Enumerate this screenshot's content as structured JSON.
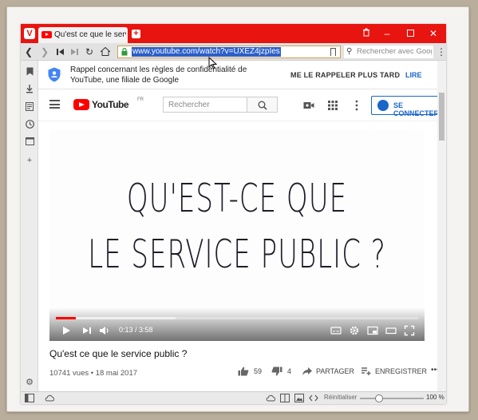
{
  "browser": {
    "logo": "V",
    "tab_title": "Qu'est ce que le service public",
    "new_tab": "+",
    "url": "www.youtube.com/watch?v=UXEZ4jzpIes",
    "search_placeholder": "Rechercher avec Goog",
    "accent": "#e8140f",
    "icons": [
      "back-icon",
      "forward-icon",
      "rewind-icon",
      "fast-forward-icon",
      "reload-icon",
      "home-icon",
      "lock-icon",
      "bookmark-icon",
      "search-icon",
      "menu-icon"
    ]
  },
  "notice": {
    "text": "Rappel concernant les règles de confidentialité de YouTube, une filiale de Google",
    "remind_later": "ME LE RAPPELER PLUS TARD",
    "read": "LIRE"
  },
  "youtube": {
    "logo_text": "YouTube",
    "region": "FR",
    "search_placeholder": "Rechercher",
    "sign_in": "SE CONNECTER"
  },
  "video": {
    "line1": "QU'EST-CE QUE",
    "line2": "LE SERVICE PUBLIC ?",
    "time": "0:13 / 3:58",
    "progress_fraction": 0.055,
    "title": "Qu'est ce que le service public ?",
    "meta": "10741 vues • 18 mai 2017",
    "likes": "59",
    "dislikes": "4",
    "share": "PARTAGER",
    "save": "ENREGISTRER",
    "more": "•••"
  },
  "status": {
    "reset": "Réinitialiser",
    "zoom": "100 %",
    "zoom_fraction": 0.3
  }
}
